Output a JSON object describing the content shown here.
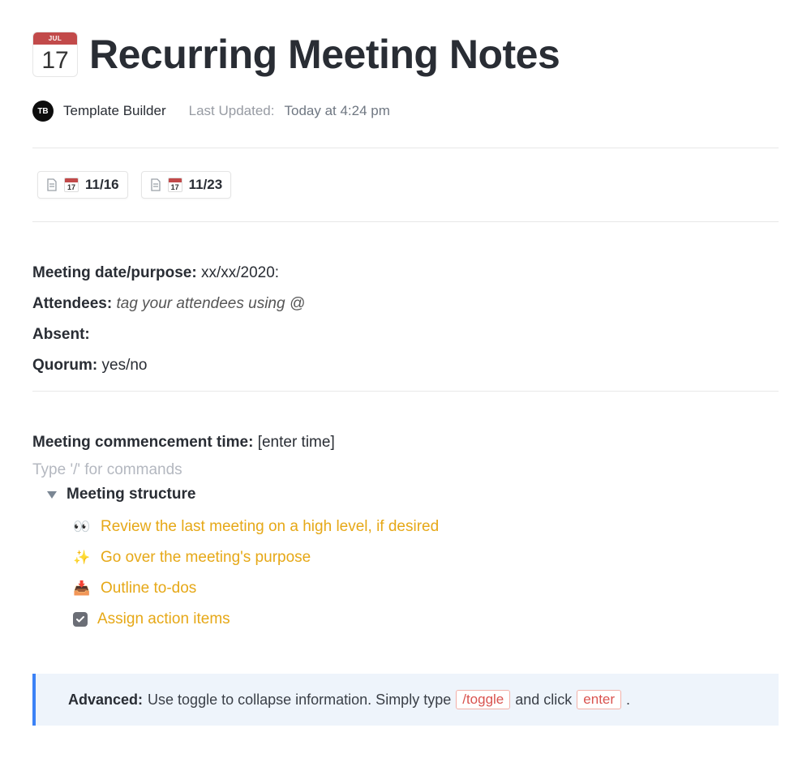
{
  "header": {
    "icon_month": "JUL",
    "icon_day": "17",
    "title": "Recurring Meeting Notes",
    "author_initials": "TB",
    "author_name": "Template Builder",
    "updated_label": "Last Updated:",
    "updated_value": "Today at 4:24 pm"
  },
  "chips": [
    {
      "mini_day": "17",
      "label": "11/16"
    },
    {
      "mini_day": "17",
      "label": "11/23"
    }
  ],
  "fields": {
    "meeting_date_label": "Meeting date/purpose:",
    "meeting_date_value": "xx/xx/2020:",
    "attendees_label": "Attendees:",
    "attendees_value": "tag your attendees using @",
    "absent_label": "Absent:",
    "absent_value": "",
    "quorum_label": "Quorum:",
    "quorum_value": "yes/no"
  },
  "commencement": {
    "label": "Meeting commencement time:",
    "value": "[enter time]"
  },
  "placeholder": "Type '/' for commands",
  "toggle_title": "Meeting structure",
  "structure": [
    {
      "emoji": "👀",
      "text": "Review the last meeting on a high level, if desired"
    },
    {
      "emoji": "✨",
      "text": "Go over the meeting's purpose"
    },
    {
      "emoji": "📥",
      "text": "Outline to-dos"
    },
    {
      "emoji": "check",
      "text": "Assign action items"
    }
  ],
  "callout": {
    "strong": "Advanced:",
    "text1": "Use toggle to collapse information. Simply type",
    "code1": "/toggle",
    "text2": "and click",
    "code2": "enter",
    "period": "."
  }
}
